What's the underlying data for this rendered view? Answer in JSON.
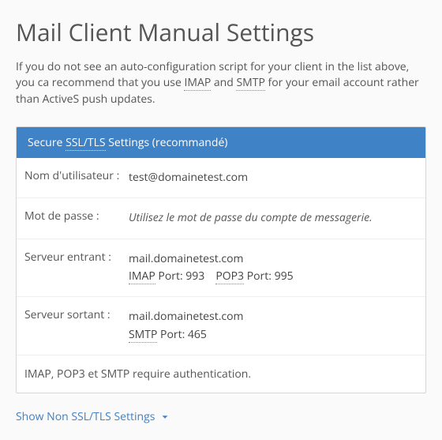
{
  "page_title": "Mail Client Manual Settings",
  "intro": {
    "part1": "If you do not see an auto-configuration script for your client in the list above, you ca",
    "part2_before_imap": " recommend that you use ",
    "imap": "IMAP",
    "between": " and ",
    "smtp": "SMTP",
    "part3": " for your email account rather than ActiveS",
    "part4": " push updates."
  },
  "panel": {
    "header_before": "Secure ",
    "header_abbr": "SSL/TLS",
    "header_after": " Settings (recommandé)"
  },
  "rows": {
    "username_label": "Nom d'utilisateur :",
    "username_value": "test@domainetest.com",
    "password_label": "Mot de passe :",
    "password_value": "Utilisez le mot de passe du compte de messagerie.",
    "incoming_label": "Serveur entrant :",
    "incoming_server": "mail.domainetest.com",
    "incoming_imap": "IMAP",
    "incoming_imap_port": " Port: 993",
    "incoming_pop3": "POP3",
    "incoming_pop3_port": " Port: 995",
    "outgoing_label": "Serveur sortant :",
    "outgoing_server": "mail.domainetest.com",
    "outgoing_smtp": "SMTP",
    "outgoing_smtp_port": " Port: 465"
  },
  "auth_note": "IMAP, POP3 et SMTP require authentication.",
  "toggle": "Show Non SSL/TLS Settings"
}
